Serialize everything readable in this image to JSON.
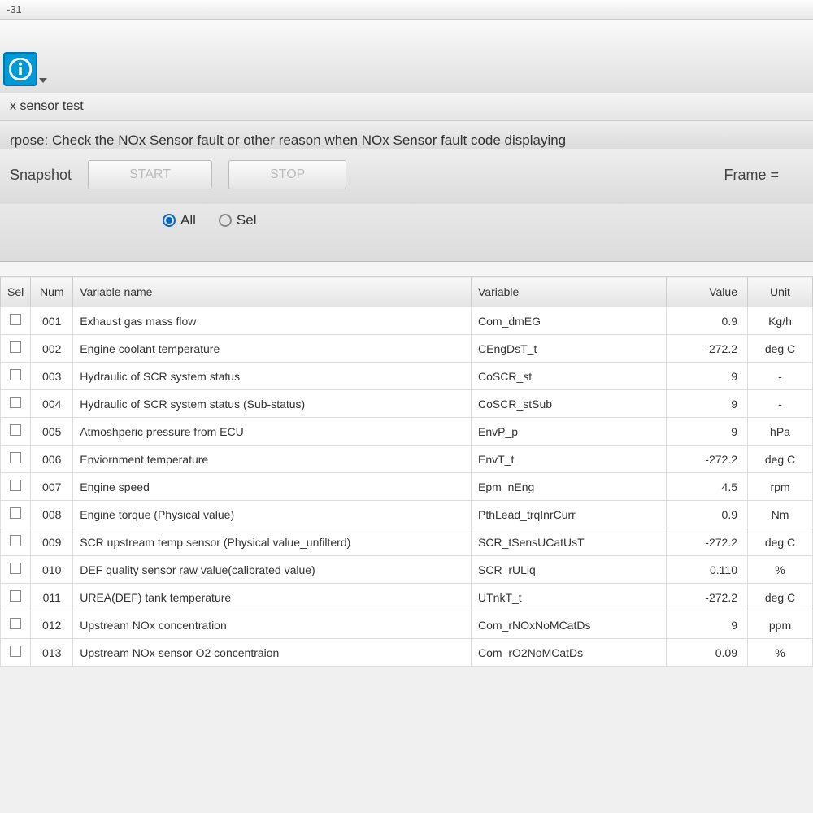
{
  "titlebar": {
    "text": "-31"
  },
  "section_title": "x sensor test",
  "purpose": "rpose: Check the NOx Sensor fault or other reason when NOx Sensor fault code displaying",
  "controls": {
    "snapshot_label": "Snapshot",
    "start_label": "START",
    "stop_label": "STOP",
    "frame_label": "Frame ="
  },
  "radio": {
    "all_label": "All",
    "sel_label": "Sel",
    "selected": "all"
  },
  "columns": {
    "sel": "Sel",
    "num": "Num",
    "varname": "Variable name",
    "variable": "Variable",
    "value": "Value",
    "unit": "Unit"
  },
  "rows": [
    {
      "num": "001",
      "name": "Exhaust gas mass flow",
      "var": "Com_dmEG",
      "value": "0.9",
      "unit": "Kg/h"
    },
    {
      "num": "002",
      "name": "Engine coolant temperature",
      "var": "CEngDsT_t",
      "value": "-272.2",
      "unit": "deg C"
    },
    {
      "num": "003",
      "name": "Hydraulic of SCR system status",
      "var": "CoSCR_st",
      "value": "9",
      "unit": "-"
    },
    {
      "num": "004",
      "name": "Hydraulic of SCR system status (Sub-status)",
      "var": "CoSCR_stSub",
      "value": "9",
      "unit": "-"
    },
    {
      "num": "005",
      "name": "Atmoshperic pressure from ECU",
      "var": "EnvP_p",
      "value": "9",
      "unit": "hPa"
    },
    {
      "num": "006",
      "name": "Enviornment temperature",
      "var": "EnvT_t",
      "value": "-272.2",
      "unit": "deg C"
    },
    {
      "num": "007",
      "name": "Engine speed",
      "var": "Epm_nEng",
      "value": "4.5",
      "unit": "rpm"
    },
    {
      "num": "008",
      "name": "Engine torque (Physical value)",
      "var": "PthLead_trqInrCurr",
      "value": "0.9",
      "unit": "Nm"
    },
    {
      "num": "009",
      "name": "SCR upstream temp sensor (Physical value_unfilterd)",
      "var": "SCR_tSensUCatUsT",
      "value": "-272.2",
      "unit": "deg C"
    },
    {
      "num": "010",
      "name": "DEF quality sensor raw value(calibrated value)",
      "var": "SCR_rULiq",
      "value": "0.110",
      "unit": "%"
    },
    {
      "num": "011",
      "name": "UREA(DEF) tank temperature",
      "var": "UTnkT_t",
      "value": "-272.2",
      "unit": "deg C"
    },
    {
      "num": "012",
      "name": "Upstream NOx concentration",
      "var": "Com_rNOxNoMCatDs",
      "value": "9",
      "unit": "ppm"
    },
    {
      "num": "013",
      "name": "Upstream NOx sensor O2 concentraion",
      "var": "Com_rO2NoMCatDs",
      "value": "0.09",
      "unit": "%"
    }
  ]
}
